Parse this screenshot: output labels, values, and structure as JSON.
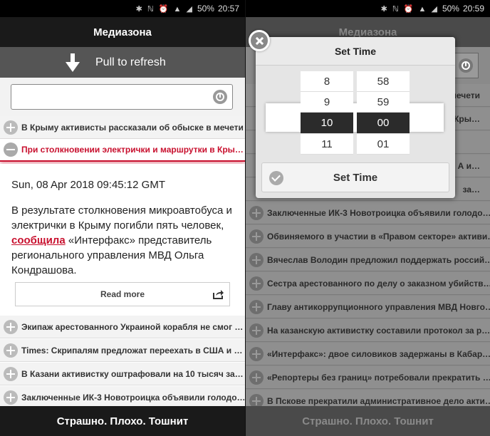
{
  "left": {
    "status": {
      "icons": "✱ ℕ ⏰ ▲ ◢",
      "battery": "50%",
      "time": "20:57"
    },
    "app_title": "Медиазона",
    "pull_to_refresh": "Pull to refresh",
    "search": {
      "value": ""
    },
    "items_top": [
      {
        "title": "В Крыму активисты рассказали об обыске в мечети",
        "expanded": false
      },
      {
        "title": "При столкновении электрички и маршрутки в Кры…",
        "expanded": true
      }
    ],
    "article": {
      "date": "Sun, 08 Apr 2018 09:45:12 GMT",
      "body_before": "В результате столкновения микроавтобуса и электрички в Крыму погибли пять человек, ",
      "link": "сообщила",
      "body_after": " «Интерфакс» представитель регионального управления МВД Ольга Кондрашова.",
      "read_more": "Read more"
    },
    "items_bottom": [
      "Экипаж арестованного Украиной корабля не смог …",
      "Times: Скрипалям предложат переехать в США и …",
      "В Казани активистку оштрафовали на 10 тысяч за…",
      "Заключенные ИК-3 Новотроицка объявили голодо…"
    ],
    "footer": "Страшно. Плохо. Тошнит"
  },
  "right": {
    "status": {
      "icons": "✱ ℕ ⏰ ▲ ◢",
      "battery": "50%",
      "time": "20:59"
    },
    "app_title": "Медиазона",
    "partial_items": [
      "мечети",
      "Кры…",
      "",
      "А и…",
      "за…"
    ],
    "items": [
      "Заключенные ИК-3 Новотроицка объявили голодо…",
      "Обвиняемого в участии в «Правом секторе» активи…",
      "Вячеслав Володин предложил поддержать россий…",
      "Сестра арестованного по делу о заказном убийств…",
      "Главу антикоррупционного управления МВД Новго…",
      "На казанскую активистку составили протокол за р…",
      "«Интерфакс»: двое силовиков задержаны в Кабар…",
      "«Репортеры без границ» потребовали прекратить …",
      "В Пскове прекратили административное дело акти…"
    ],
    "dialog": {
      "title": "Set Time",
      "hours": [
        "8",
        "9",
        "10",
        "11"
      ],
      "minutes": [
        "58",
        "59",
        "00",
        "01"
      ],
      "selected_hour": "10",
      "selected_minute": "00",
      "button": "Set Time"
    },
    "footer": "Страшно. Плохо. Тошнит"
  },
  "colors": {
    "accent": "#c8102e",
    "bar": "#1a1a1a",
    "pull": "#555555"
  }
}
